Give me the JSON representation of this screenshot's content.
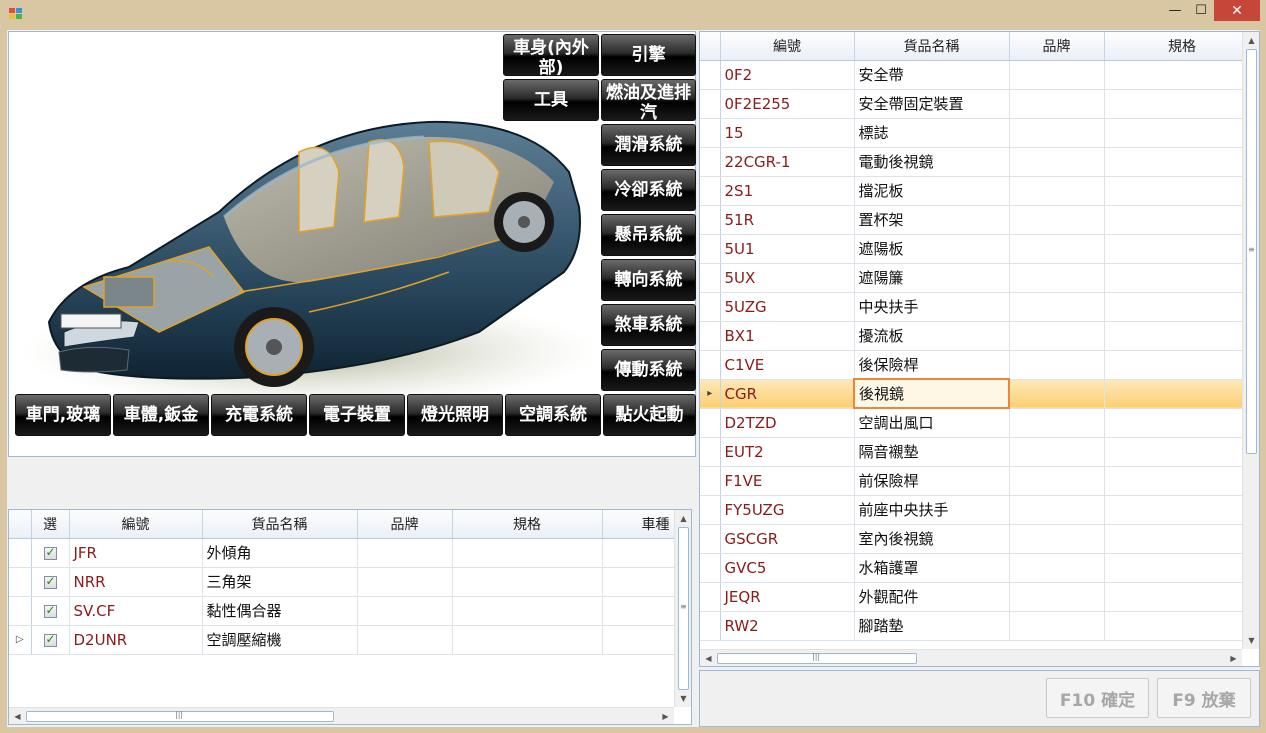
{
  "window": {
    "minimize": "—",
    "maximize": "☐",
    "close": "✕"
  },
  "systems": {
    "body_inner_outer": "車身(內外部)",
    "engine": "引擎",
    "tools": "工具",
    "fuel_intake_exhaust": "燃油及進排汽",
    "lubrication": "潤滑系統",
    "cooling": "冷卻系統",
    "suspension": "懸吊系統",
    "steering": "轉向系統",
    "brake": "煞車系統",
    "transmission": "傳動系統",
    "door_glass": "車門,玻璃",
    "body_sheet_metal": "車體,鈑金",
    "charging": "充電系統",
    "electronics": "電子裝置",
    "lighting": "燈光照明",
    "air_conditioning": "空調系統",
    "ignition_start": "點火起動"
  },
  "selected_grid": {
    "headers": [
      "選",
      "編號",
      "貨品名稱",
      "品牌",
      "規格",
      "車種"
    ],
    "rows": [
      {
        "code": "JFR",
        "name": "外傾角",
        "current": false
      },
      {
        "code": "NRR",
        "name": "三角架",
        "current": false
      },
      {
        "code": "SV.CF",
        "name": "黏性偶合器",
        "current": false
      },
      {
        "code": "D2UNR",
        "name": "空調壓縮機",
        "current": true
      }
    ]
  },
  "parts_grid": {
    "headers": [
      "編號",
      "貨品名稱",
      "品牌",
      "規格"
    ],
    "rows": [
      {
        "code": "0F2",
        "name": "安全帶"
      },
      {
        "code": "0F2E255",
        "name": "安全帶固定裝置"
      },
      {
        "code": "15",
        "name": "標誌"
      },
      {
        "code": "22CGR-1",
        "name": "電動後視鏡"
      },
      {
        "code": "2S1",
        "name": "擋泥板"
      },
      {
        "code": "51R",
        "name": "置杯架"
      },
      {
        "code": "5U1",
        "name": "遮陽板"
      },
      {
        "code": "5UX",
        "name": "遮陽簾"
      },
      {
        "code": "5UZG",
        "name": "中央扶手"
      },
      {
        "code": "BX1",
        "name": "擾流板"
      },
      {
        "code": "C1VE",
        "name": "後保險桿"
      },
      {
        "code": "CGR",
        "name": "後視鏡"
      },
      {
        "code": "D2TZD",
        "name": "空調出風口"
      },
      {
        "code": "EUT2",
        "name": "隔音襯墊"
      },
      {
        "code": "F1VE",
        "name": "前保險桿"
      },
      {
        "code": "FY5UZG",
        "name": "前座中央扶手"
      },
      {
        "code": "GSCGR",
        "name": "室內後視鏡"
      },
      {
        "code": "GVC5",
        "name": "水箱護罩"
      },
      {
        "code": "JEQR",
        "name": "外觀配件"
      },
      {
        "code": "RW2",
        "name": "腳踏墊"
      }
    ],
    "selected_index": 11
  },
  "actions": {
    "confirm": "F10 確定",
    "cancel": "F9 放棄"
  },
  "colors": {
    "title_bar": "#d9c6a3",
    "close_button": "#c7463a",
    "part_code_text": "#8b1a1a",
    "selection": "#fbcf72",
    "grid_border": "#9db9d6"
  }
}
